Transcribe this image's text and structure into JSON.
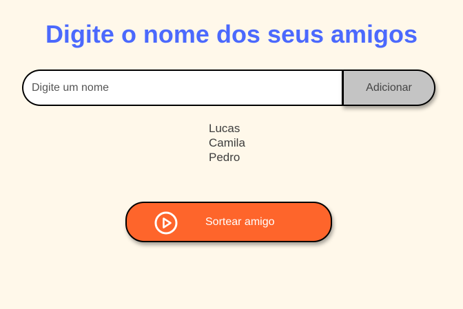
{
  "page": {
    "title": "Digite o nome dos seus amigos"
  },
  "input": {
    "placeholder": "Digite um nome",
    "value": ""
  },
  "add_button": {
    "label": "Adicionar"
  },
  "friends": [
    "Lucas",
    "Camila",
    "Pedro"
  ],
  "draw_button": {
    "label": "Sortear amigo",
    "icon": "play-circle-icon"
  },
  "colors": {
    "background": "#FFF8EA",
    "title": "#4B69FD",
    "add_button": "#C4C4C4",
    "draw_button": "#FE652B"
  }
}
